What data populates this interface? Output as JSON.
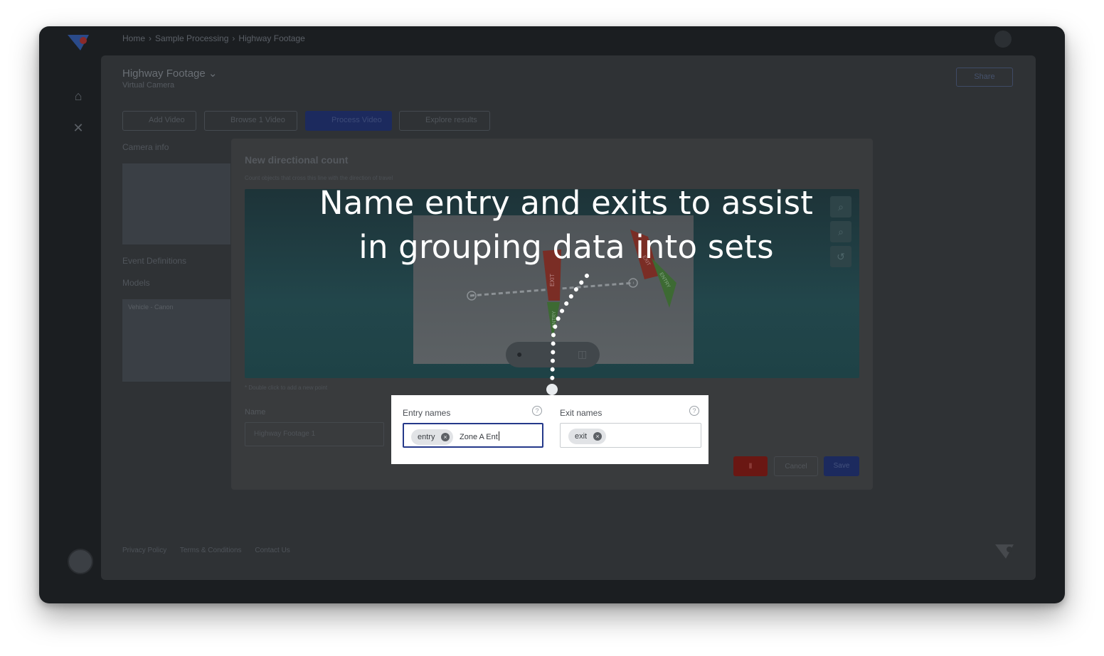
{
  "breadcrumb": {
    "items": [
      "Home",
      "Sample Processing",
      "Highway Footage"
    ],
    "separator": "›"
  },
  "project": {
    "title": "Highway Footage",
    "subtitle": "Virtual Camera"
  },
  "toolbar": {
    "share_label": "Share",
    "add_video": "Add Video",
    "browse_videos": "Browse 1 Video",
    "process_video": "Process Video",
    "explore_results": "Explore results"
  },
  "panels": {
    "camera_info": "Camera info",
    "event_definitions": "Event Definitions",
    "models": "Models",
    "model_tag": "Vehicle - Canon"
  },
  "modal": {
    "title": "New directional count",
    "subtitle": "Count objects that cross this line with the direction of travel",
    "hint": "* Double click to add a new point",
    "name_label": "Name",
    "name_value": "Highway Footage 1",
    "cancel_label": "Cancel",
    "save_label": "Save",
    "line_labels": {
      "exit_left": "EXIT",
      "entry_left": "ENTRY",
      "exit_right": "EXIT",
      "entry_right": "ENTRY"
    }
  },
  "entry_field": {
    "label": "Entry names",
    "chips": [
      "entry"
    ],
    "typed_value": "Zone A Ent"
  },
  "exit_field": {
    "label": "Exit names",
    "chips": [
      "exit"
    ]
  },
  "caption": {
    "line1": "Name entry and exits to assist",
    "line2": "in grouping data into sets"
  },
  "footer": {
    "links": [
      "Privacy Policy",
      "Terms & Conditions",
      "Contact Us"
    ]
  },
  "colors": {
    "overlay_bg": "#1b1e21",
    "accent_blue": "#25398a",
    "delete_red": "#6a1713",
    "highlight_bg": "#ffffff",
    "caption_text": "#ffffff"
  },
  "icons": {
    "home": "home-icon",
    "tools": "tools-icon",
    "help": "question-circle-icon",
    "chip_remove": "close-circle-icon",
    "zoom_in": "zoom-in-icon",
    "zoom_out": "zoom-out-icon",
    "reset": "reset-icon",
    "pin": "map-pin-icon",
    "split": "split-view-icon"
  }
}
